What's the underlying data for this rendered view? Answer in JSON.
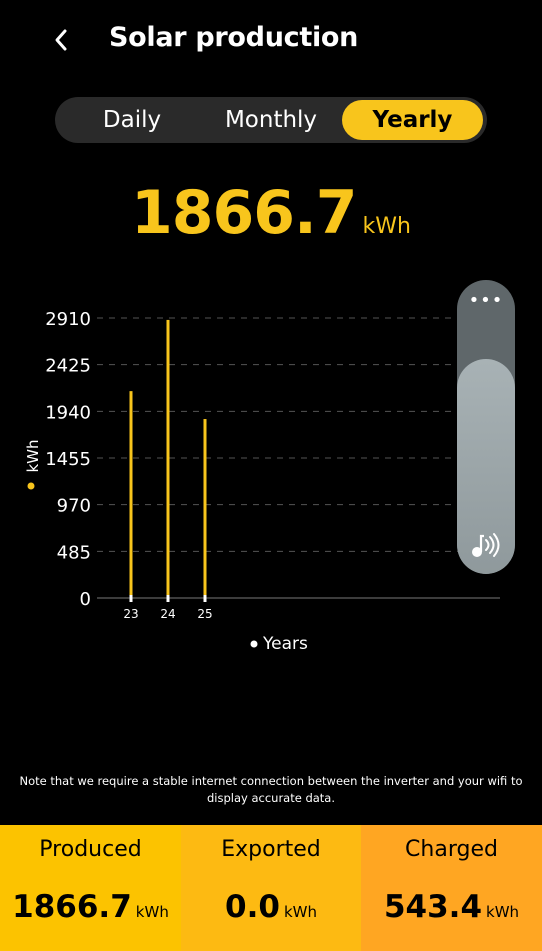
{
  "header": {
    "title": "Solar production",
    "back_icon": "chevron-left-icon"
  },
  "tabs": [
    {
      "label": "Daily",
      "active": false
    },
    {
      "label": "Monthly",
      "active": false
    },
    {
      "label": "Yearly",
      "active": true
    }
  ],
  "summary": {
    "value": "1866.7",
    "unit": "kWh"
  },
  "chart_data": {
    "type": "bar",
    "categories": [
      "23",
      "24",
      "25"
    ],
    "values": [
      2150,
      2890,
      1860
    ],
    "ylabel": "kWh",
    "xlabel": "Years",
    "yticks": [
      0,
      485,
      970,
      1455,
      1940,
      2425,
      2910
    ],
    "ylim": [
      0,
      2910
    ],
    "grid": true,
    "bar_color": "#f8c51c"
  },
  "floating_panel": {
    "menu_icon": "more-icon",
    "sound_icon": "music-note-icon"
  },
  "note": "Note that we require a stable internet connection between the inverter and your wifi to display accurate data.",
  "stats": [
    {
      "label": "Produced",
      "value": "1866.7",
      "unit": "kWh",
      "color": "#fcc300"
    },
    {
      "label": "Exported",
      "value": "0.0",
      "unit": "kWh",
      "color": "#fdba12"
    },
    {
      "label": "Charged",
      "value": "543.4",
      "unit": "kWh",
      "color": "#ffa622"
    }
  ],
  "colors": {
    "accent": "#f8c51c",
    "background": "#000000"
  }
}
